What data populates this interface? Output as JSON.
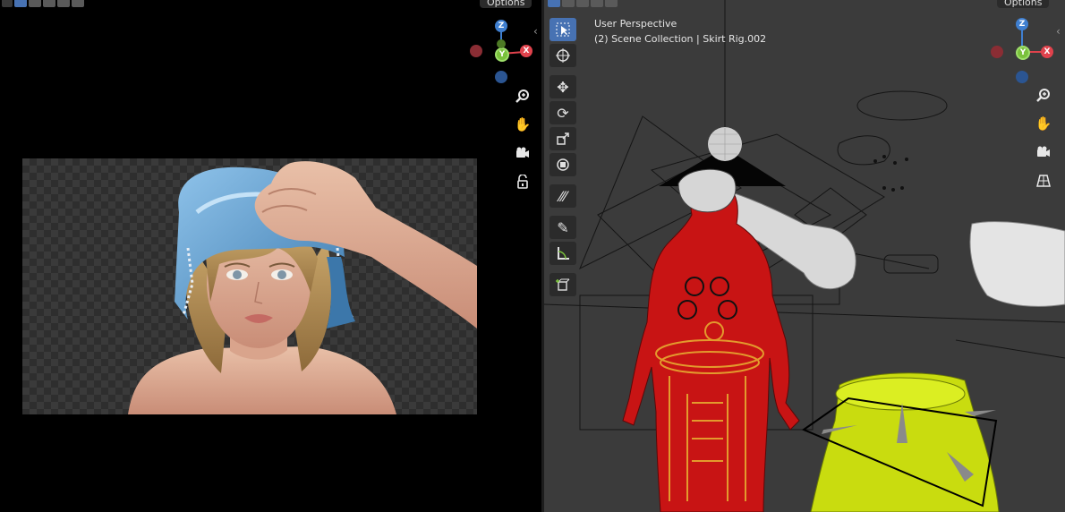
{
  "left_viewport": {
    "options_label": "Options",
    "gizmo": {
      "z": "Z",
      "x": "X",
      "y": "Y"
    },
    "nav_icons": [
      "zoom-icon",
      "pan-hand-icon",
      "camera-icon",
      "lock-icon"
    ]
  },
  "right_viewport": {
    "options_label": "Options",
    "view_name": "User Perspective",
    "collection_info": "(2) Scene Collection | Skirt Rig.002",
    "gizmo": {
      "z": "Z",
      "x": "X",
      "y": "Y"
    },
    "tools": [
      "select-box-icon",
      "cursor-icon",
      "move-icon",
      "rotate-icon",
      "scale-icon",
      "transform-icon",
      "annotate-icon",
      "draw-icon",
      "measure-icon",
      "add-cube-icon"
    ],
    "nav_icons": [
      "zoom-icon",
      "pan-hand-icon",
      "camera-icon",
      "grid-icon"
    ]
  },
  "colors": {
    "x_axis": "#e0424c",
    "y_axis": "#7ac13c",
    "z_axis": "#3f7fd0",
    "accent": "#4772b3"
  }
}
